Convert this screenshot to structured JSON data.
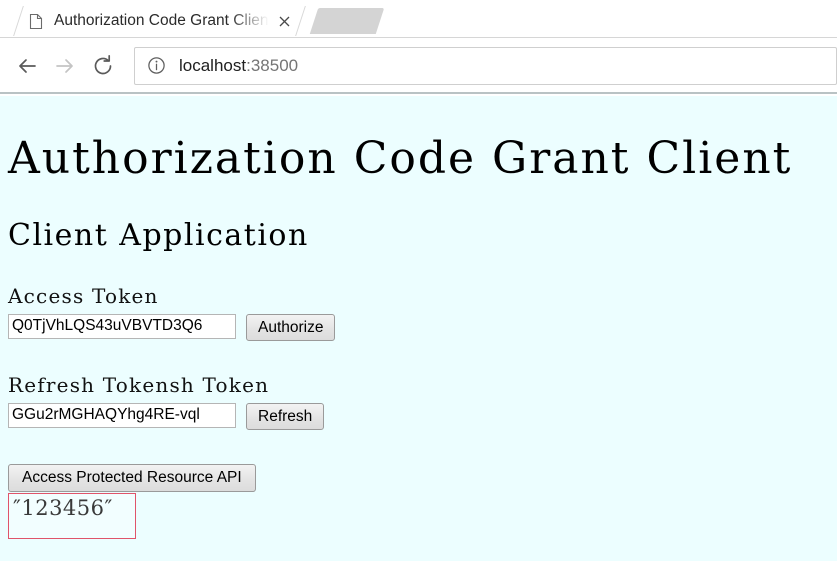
{
  "browser": {
    "tab": {
      "title": "Authorization Code Grant Client",
      "favicon_icon": "page-icon",
      "close_icon": "close-icon"
    },
    "inactive_tab": {
      "title": ""
    },
    "toolbar": {
      "back_icon": "arrow-left-icon",
      "forward_icon": "arrow-right-icon",
      "reload_icon": "reload-icon",
      "site_info_icon": "info-circle-icon",
      "url_host": "localhost",
      "url_port": ":38500"
    }
  },
  "page": {
    "heading": "Authorization Code Grant Client",
    "subheading": "Client Application",
    "access_token": {
      "label": "Access Token",
      "value": "Q0TjVhLQS43uVBVTD3Q6",
      "button": "Authorize"
    },
    "refresh_token": {
      "label": "Refresh Tokensh Token",
      "value": "GGu2rMGHAQYhg4RE-vql",
      "button": "Refresh"
    },
    "protected_resource": {
      "button": "Access Protected Resource API",
      "result": "″123456″"
    },
    "colors": {
      "page_background": "#ECFEFF",
      "result_border": "#E0546A",
      "heading_text": "#000000"
    }
  }
}
